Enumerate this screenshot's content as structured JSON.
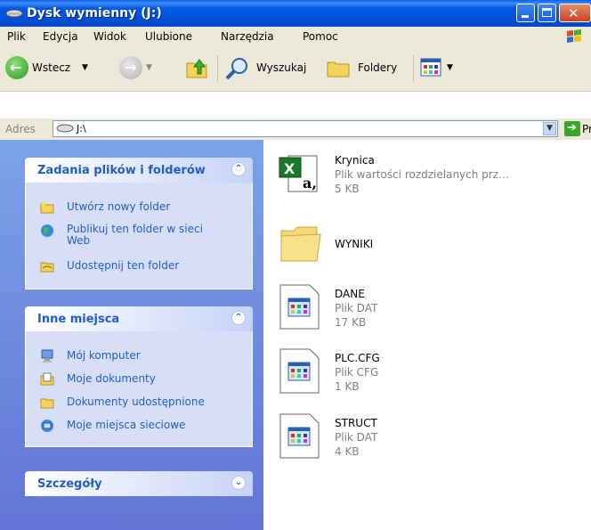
{
  "window": {
    "title": "Dysk wymienny (J:)"
  },
  "menu": {
    "items": [
      "Plik",
      "Edycja",
      "Widok",
      "Ulubione",
      "Narzędzia",
      "Pomoc"
    ]
  },
  "toolbar": {
    "back_label": "Wstecz",
    "search_label": "Wyszukaj",
    "folders_label": "Foldery"
  },
  "address": {
    "label": "Adres",
    "value": "J:\\",
    "go_label": "Przejdź"
  },
  "tasks": {
    "file_tasks": {
      "title": "Zadania plików i folderów",
      "items": [
        "Utwórz nowy folder",
        "Publikuj ten folder w sieci Web",
        "Udostępnij ten folder"
      ]
    },
    "other_places": {
      "title": "Inne miejsca",
      "items": [
        "Mój komputer",
        "Moje dokumenty",
        "Dokumenty udostępnione",
        "Moje miejsca sieciowe"
      ]
    },
    "details": {
      "title": "Szczegóły"
    }
  },
  "files": [
    {
      "name": "Krynica",
      "type": "Plik wartości rozdzielanych prz…",
      "size": "5 KB",
      "icon": "excel-csv-icon"
    },
    {
      "name": "WYNIKI",
      "type": "",
      "size": "",
      "icon": "folder-icon"
    },
    {
      "name": "DANE",
      "type": "Plik DAT",
      "size": "17 KB",
      "icon": "dat-file-icon"
    },
    {
      "name": "PLC.CFG",
      "type": "Plik CFG",
      "size": "1 KB",
      "icon": "cfg-file-icon"
    },
    {
      "name": "STRUCT",
      "type": "Plik DAT",
      "size": "4 KB",
      "icon": "dat-file-icon"
    }
  ]
}
